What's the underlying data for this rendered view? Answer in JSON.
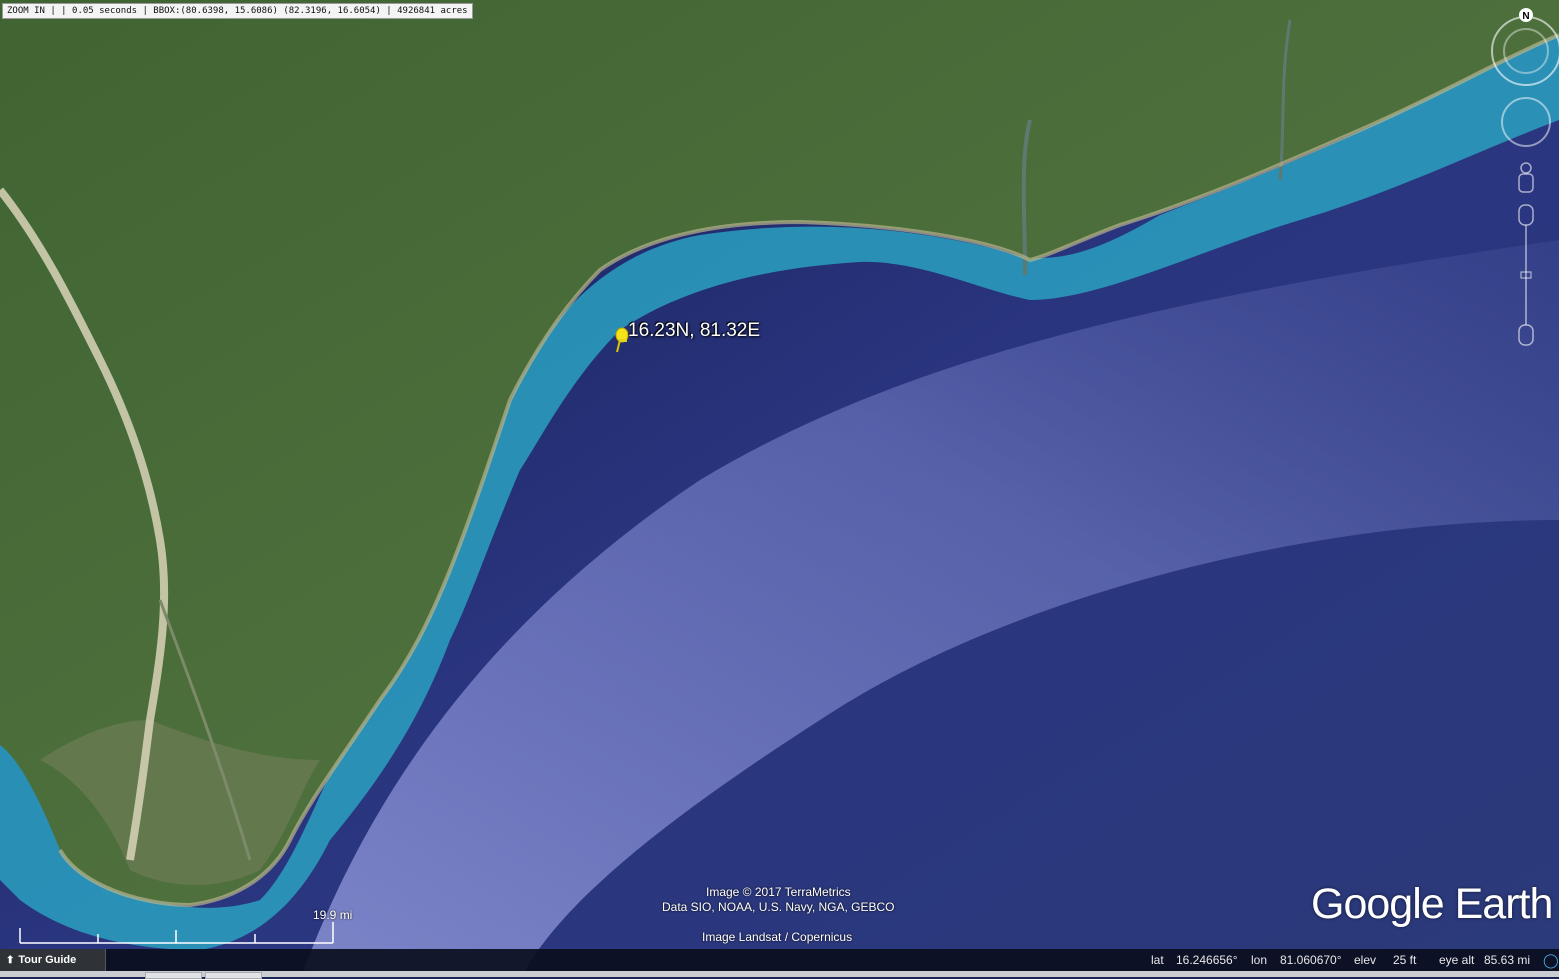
{
  "toolbar": {
    "overlay_text": "ZOOM IN |  | 0.05 seconds | BBOX:(80.6398, 15.6086) (82.3196, 16.6054) | 4926841 acres"
  },
  "placemark": {
    "label": "16.23N, 81.32E",
    "icon": "yellow-pushpin-icon"
  },
  "credits": {
    "line1": "Image © 2017 TerraMetrics",
    "line2": "Data SIO, NOAA, U.S. Navy, NGA, GEBCO",
    "line3": "Image Landsat / Copernicus"
  },
  "brand": "Google Earth",
  "scale": {
    "label": "19.9 mi"
  },
  "compass": {
    "north_label": "N"
  },
  "statusbar": {
    "tour_guide": "Tour Guide",
    "lat_label": "lat",
    "lat_value": "16.246656°",
    "lon_label": "lon",
    "lon_value": "81.060670°",
    "elev_label": "elev",
    "elev_value": "25 ft",
    "eye_alt_label": "eye alt",
    "eye_alt_value": "85.63 mi"
  },
  "colors": {
    "land": "#4f6f3a",
    "shallow_water": "#2aa0c0",
    "deep_water": "#1e2a66",
    "sediment_plume": "#6f78c8",
    "pin": "#f4e21a"
  }
}
